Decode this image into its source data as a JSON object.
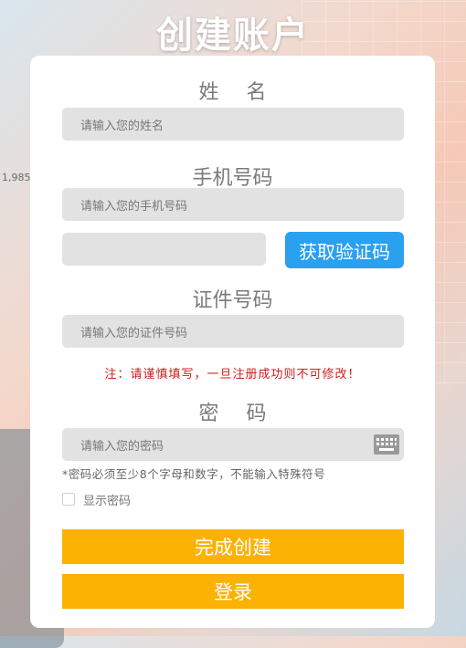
{
  "header": {
    "title": "创建账户"
  },
  "background": {
    "number_fragment": "1,985"
  },
  "form": {
    "name_label": "姓名",
    "name_placeholder": "请输入您的姓名",
    "phone_label": "手机号码",
    "phone_placeholder": "请输入您的手机号码",
    "code_value": "",
    "get_code_label": "获取验证码",
    "id_label": "证件号码",
    "id_placeholder": "请输入您的证件号码",
    "notice": "注：请谨慎填写，一旦注册成功则不可修改！",
    "password_label": "密码",
    "password_placeholder": "请输入您的密码",
    "password_hint": "*密码必须至少8个字母和数字，不能输入特殊符号",
    "show_password_label": "显示密码",
    "show_password_checked": false
  },
  "actions": {
    "create_label": "完成创建",
    "login_label": "登录"
  },
  "colors": {
    "code_button": "#2aa0f0",
    "primary_button": "#fbb202",
    "notice_text": "#d11b1b",
    "input_bg": "#e2e2e2"
  },
  "icons": {
    "keyboard": "keyboard-icon"
  }
}
